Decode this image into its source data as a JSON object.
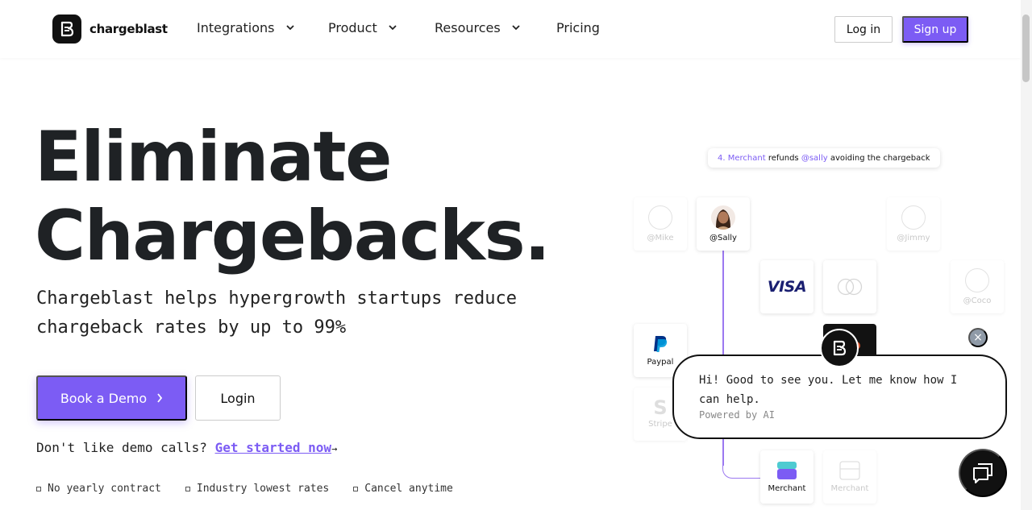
{
  "nav": {
    "brand": "chargeblast",
    "items": [
      {
        "label": "Integrations",
        "dropdown": true
      },
      {
        "label": "Product",
        "dropdown": true
      },
      {
        "label": "Resources",
        "dropdown": true
      },
      {
        "label": "Pricing",
        "dropdown": false
      }
    ],
    "login_label": "Log in",
    "signup_label": "Sign up"
  },
  "hero": {
    "headline_line1": "Eliminate",
    "headline_line2": "Chargebacks.",
    "subtitle": "Chargeblast helps hypergrowth startups reduce chargeback rates by up to 99%",
    "demo_button": "Book a Demo",
    "login_button": "Login",
    "demo_prompt": "Don't like demo calls?",
    "get_started": "Get started now",
    "get_started_arrow": "→",
    "features": [
      "No yearly contract",
      "Industry lowest rates",
      "Cancel anytime"
    ]
  },
  "illustration": {
    "step_number": "4.",
    "step_actor": "Merchant",
    "step_verb": "refunds",
    "step_user": "@sally",
    "step_rest": "avoiding the chargeback",
    "cards": {
      "mike": "@Mike",
      "sally": "@Sally",
      "jimmy": "@Jimmy",
      "coco": "@Coco",
      "visa": "VISA",
      "paypal": "Paypal",
      "stripe": "Stripe",
      "merchant": "Merchant",
      "merchant_faded": "Merchant"
    }
  },
  "chat": {
    "message": "Hi! Good to see you. Let me know how I can help.",
    "powered_by": "Powered by AI",
    "close_symbol": "×"
  },
  "colors": {
    "accent": "#7c5cf4",
    "text": "#1f2225",
    "visa_blue": "#1a1f71",
    "paypal_blue": "#003087"
  }
}
